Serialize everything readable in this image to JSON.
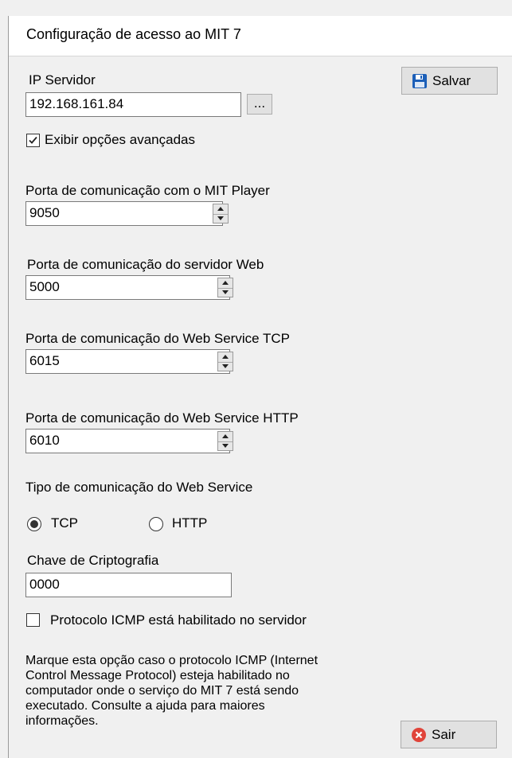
{
  "window": {
    "title": "Configuração de acesso ao MIT 7"
  },
  "server": {
    "ip_label": "IP Servidor",
    "ip_value": "192.168.161.84",
    "browse_label": "..."
  },
  "save_button": {
    "label": "Salvar"
  },
  "advanced": {
    "label": "Exibir opções avançadas",
    "checked": true
  },
  "ports": [
    {
      "label": "Porta de comunicação com o MIT Player",
      "value": "9050"
    },
    {
      "label": "Porta de comunicação do servidor Web",
      "value": "5000"
    },
    {
      "label": "Porta de comunicação do Web Service TCP",
      "value": "6015"
    },
    {
      "label": "Porta de comunicação do Web Service HTTP",
      "value": "6010"
    }
  ],
  "ws_type": {
    "label": "Tipo de comunicação do Web Service",
    "options": [
      {
        "label": "TCP",
        "selected": true
      },
      {
        "label": "HTTP",
        "selected": false
      }
    ]
  },
  "crypto": {
    "label": "Chave de Criptografia",
    "value": "0000"
  },
  "icmp": {
    "label": "Protocolo ICMP está habilitado no servidor",
    "checked": false,
    "description": [
      "Marque esta opção caso o protocolo ICMP (Internet",
      "Control Message Protocol) esteja habilitado no",
      "computador onde o serviço do MIT 7 está sendo",
      "executado. Consulte a ajuda para maiores",
      "informações."
    ]
  },
  "exit_button": {
    "label": "Sair"
  },
  "colors": {
    "save_icon": "#1c5fb8",
    "exit_icon": "#e0443a",
    "window_bg": "#f0f0f0"
  }
}
